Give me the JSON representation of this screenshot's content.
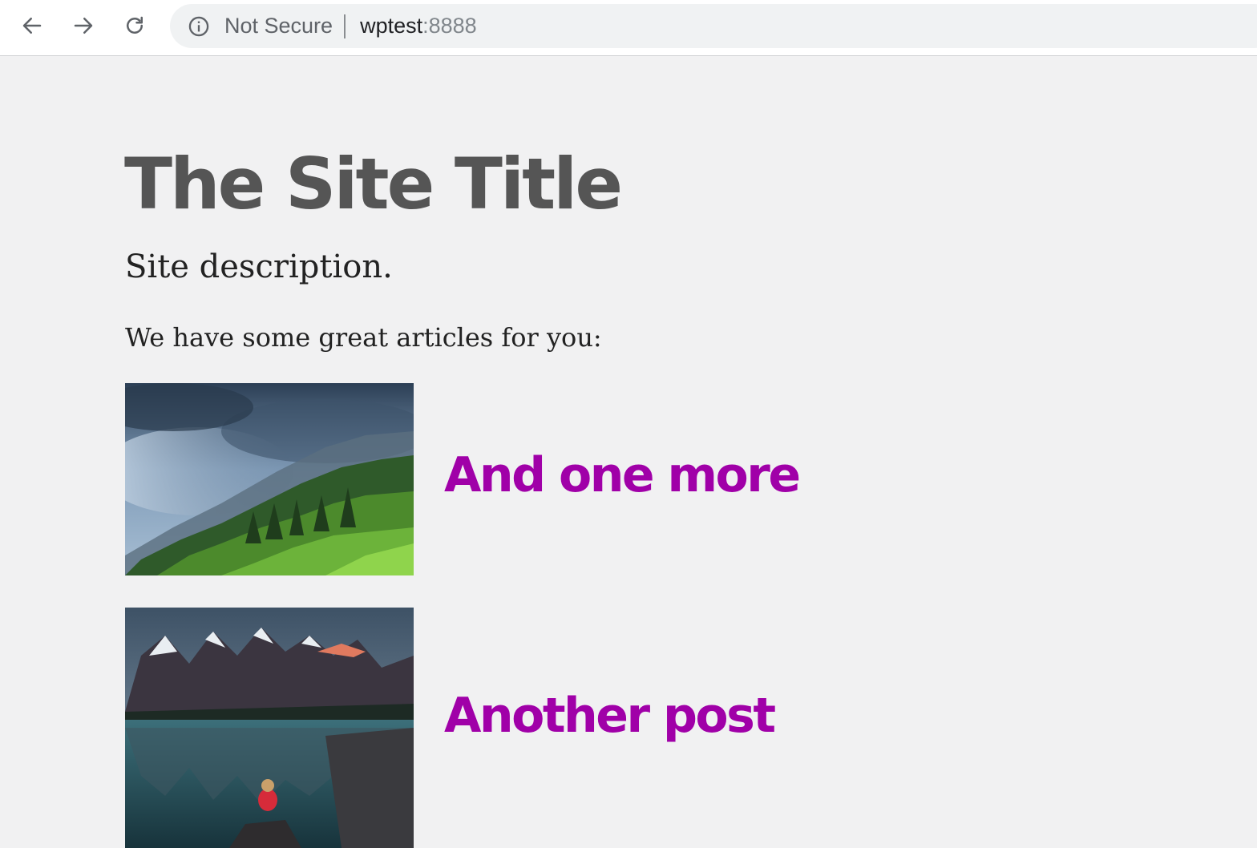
{
  "browser": {
    "security_label": "Not Secure",
    "url_host": "wptest",
    "url_rest": ":8888"
  },
  "site": {
    "title": "The Site Title",
    "description": "Site description.",
    "intro": "We have some great articles for you:"
  },
  "posts": [
    {
      "title": "And one more",
      "image": "misty-forest-mountain"
    },
    {
      "title": "Another post",
      "image": "mountain-lake-person"
    }
  ],
  "colors": {
    "page_background": "#f1f1f2",
    "title_color": "#555555",
    "link_color": "#a000a8",
    "text_color": "#222222"
  },
  "icons": {
    "back": "arrow-left-icon",
    "forward": "arrow-right-icon",
    "reload": "reload-icon",
    "info": "info-icon"
  }
}
